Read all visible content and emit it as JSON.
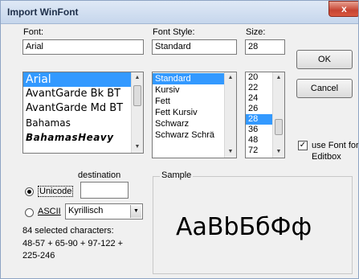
{
  "window": {
    "title": "Import WinFont",
    "close_glyph": "x"
  },
  "font": {
    "label": "Font:",
    "value": "Arial",
    "items": [
      {
        "label": "Arial",
        "selected": true
      },
      {
        "label": "AvantGarde Bk BT",
        "selected": false
      },
      {
        "label": "AvantGarde Md BT",
        "selected": false
      },
      {
        "label": "Bahamas",
        "selected": false
      },
      {
        "label": "BahamasHeavy",
        "selected": false
      }
    ]
  },
  "style": {
    "label": "Font Style:",
    "value": "Standard",
    "items": [
      {
        "label": "Standard",
        "selected": true
      },
      {
        "label": "Kursiv",
        "selected": false
      },
      {
        "label": "Fett",
        "selected": false
      },
      {
        "label": "Fett Kursiv",
        "selected": false
      },
      {
        "label": "Schwarz",
        "selected": false
      },
      {
        "label": "Schwarz Schrä",
        "selected": false
      }
    ]
  },
  "size": {
    "label": "Size:",
    "value": "28",
    "items": [
      {
        "label": "20",
        "selected": false
      },
      {
        "label": "22",
        "selected": false
      },
      {
        "label": "24",
        "selected": false
      },
      {
        "label": "26",
        "selected": false
      },
      {
        "label": "28",
        "selected": true
      },
      {
        "label": "36",
        "selected": false
      },
      {
        "label": "48",
        "selected": false
      },
      {
        "label": "72",
        "selected": false
      }
    ]
  },
  "buttons": {
    "ok": "OK",
    "cancel": "Cancel"
  },
  "editbox_option": {
    "label_line1": "use Font for",
    "label_line2": "Editbox",
    "checked": true
  },
  "destination": {
    "label": "destination",
    "value": ""
  },
  "encoding": {
    "unicode_label": "Unicode",
    "ascii_label": "ASCII",
    "selected": "Unicode",
    "codepage_value": "Kyrillisch"
  },
  "selection_info": {
    "line1": "84 selected characters:",
    "line2": "48-57 + 65-90 + 97-122 +",
    "line3": "225-246"
  },
  "sample": {
    "label": "Sample",
    "text": "AaBbБбФф"
  }
}
